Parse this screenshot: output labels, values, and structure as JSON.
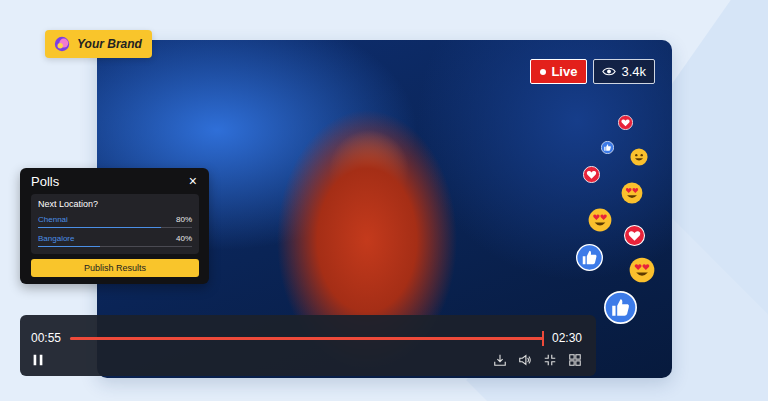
{
  "brand": {
    "label": "Your Brand"
  },
  "live_badge": {
    "label": "Live"
  },
  "viewers": {
    "count": "3.4k"
  },
  "polls": {
    "title": "Polls",
    "close": "×",
    "question": "Next Location?",
    "options": [
      {
        "label": "Chennai",
        "percent": "80%",
        "level": 0.8
      },
      {
        "label": "Bangalore",
        "percent": "40%",
        "level": 0.4
      }
    ],
    "button": "Publish Results"
  },
  "player": {
    "elapsed": "00:55",
    "total": "02:30",
    "level": 1.0,
    "playing": true
  },
  "reactions": [
    {
      "kind": "like"
    },
    {
      "kind": "heart"
    },
    {
      "kind": "smile"
    },
    {
      "kind": "heart"
    },
    {
      "kind": "hearteyes"
    },
    {
      "kind": "hearteyes"
    },
    {
      "kind": "heart"
    },
    {
      "kind": "like"
    },
    {
      "kind": "hearteyes"
    },
    {
      "kind": "like"
    }
  ]
}
